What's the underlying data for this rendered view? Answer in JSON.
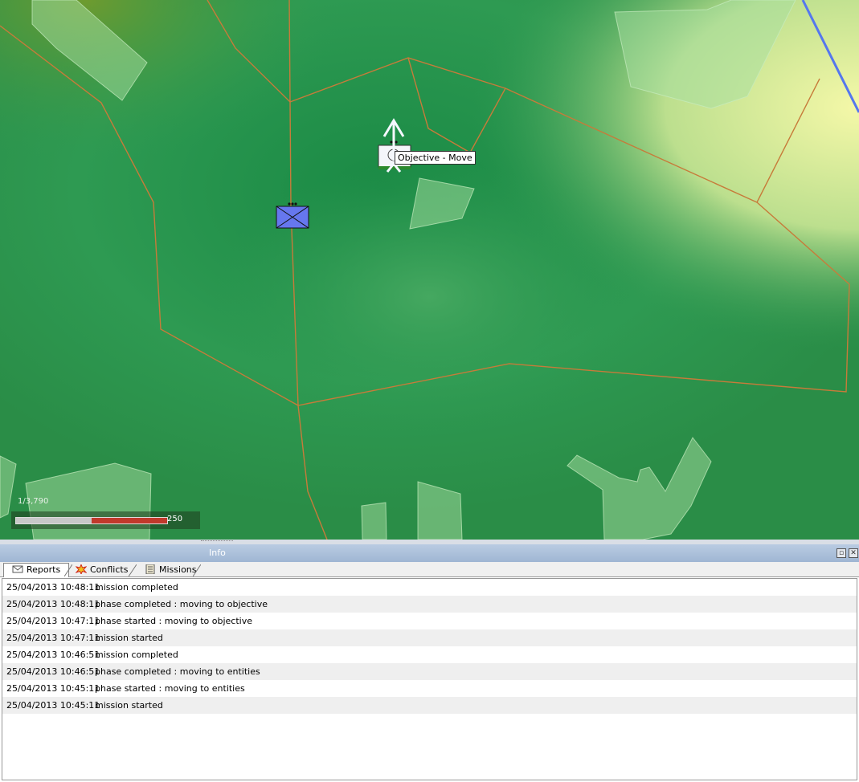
{
  "map": {
    "tooltip": "Objective - Move",
    "scale": {
      "ratio": "1/3,790",
      "end_label": "250"
    },
    "colors": {
      "boundary": "#c77b3a",
      "river": "#5577ee",
      "unit": "#6677ee"
    }
  },
  "panel": {
    "title": "Info",
    "buttons": [
      "restore-icon",
      "close-icon"
    ]
  },
  "tabs": [
    {
      "label": "Reports",
      "icon": "envelope-icon",
      "active": true
    },
    {
      "label": "Conflicts",
      "icon": "star-burst-icon",
      "active": false
    },
    {
      "label": "Missions",
      "icon": "list-icon",
      "active": false
    }
  ],
  "reports": [
    {
      "time": "25/04/2013 10:48:11",
      "message": "mission completed"
    },
    {
      "time": "25/04/2013 10:48:11",
      "message": "phase completed : moving to objective"
    },
    {
      "time": "25/04/2013 10:47:11",
      "message": "phase started : moving to objective"
    },
    {
      "time": "25/04/2013 10:47:11",
      "message": "mission started"
    },
    {
      "time": "25/04/2013 10:46:51",
      "message": "mission completed"
    },
    {
      "time": "25/04/2013 10:46:51",
      "message": "phase completed : moving to entities"
    },
    {
      "time": "25/04/2013 10:45:11",
      "message": "phase started : moving to entities"
    },
    {
      "time": "25/04/2013 10:45:11",
      "message": "mission started"
    }
  ]
}
